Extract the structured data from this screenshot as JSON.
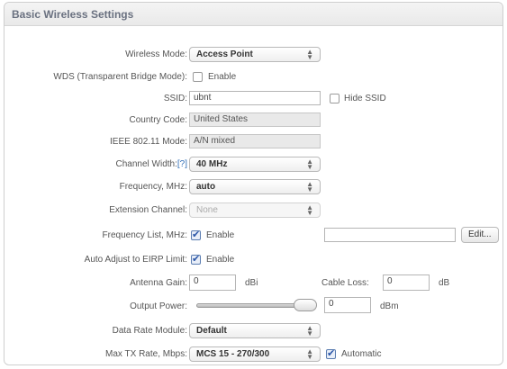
{
  "panel": {
    "title": "Basic Wireless Settings"
  },
  "wireless_mode": {
    "label": "Wireless Mode:",
    "value": "Access Point"
  },
  "wds": {
    "label": "WDS (Transparent Bridge Mode):",
    "checkbox_label": "Enable",
    "checked": false
  },
  "ssid": {
    "label": "SSID:",
    "value": "ubnt",
    "hide_label": "Hide SSID",
    "hide_checked": false
  },
  "country_code": {
    "label": "Country Code:",
    "value": "United States"
  },
  "ieee_mode": {
    "label": "IEEE 802.11 Mode:",
    "value": "A/N mixed"
  },
  "channel_width": {
    "label": "Channel Width:",
    "help": "[?]",
    "value": "40 MHz"
  },
  "frequency": {
    "label": "Frequency, MHz:",
    "value": "auto"
  },
  "extension_channel": {
    "label": "Extension Channel:",
    "value": "None"
  },
  "frequency_list": {
    "label": "Frequency List, MHz:",
    "checkbox_label": "Enable",
    "checked": true,
    "value": "",
    "edit_label": "Edit..."
  },
  "eirp": {
    "label": "Auto Adjust to EIRP Limit:",
    "checkbox_label": "Enable",
    "checked": true
  },
  "antenna_gain": {
    "label": "Antenna Gain:",
    "value": "0",
    "unit": "dBi"
  },
  "cable_loss": {
    "label": "Cable Loss:",
    "value": "0",
    "unit": "dB"
  },
  "output_power": {
    "label": "Output Power:",
    "value": "0",
    "unit": "dBm",
    "level": 1.0
  },
  "data_rate_module": {
    "label": "Data Rate Module:",
    "value": "Default"
  },
  "max_tx_rate": {
    "label": "Max TX Rate, Mbps:",
    "value": "MCS 15 - 270/300",
    "auto_label": "Automatic",
    "auto_checked": true
  },
  "icons": {
    "dropdown": "updown-arrows-icon",
    "check": "checkmark-icon"
  },
  "colors": {
    "header_title": "#6a7180",
    "help_link": "#2f6db5",
    "check": "#2b56a8"
  }
}
